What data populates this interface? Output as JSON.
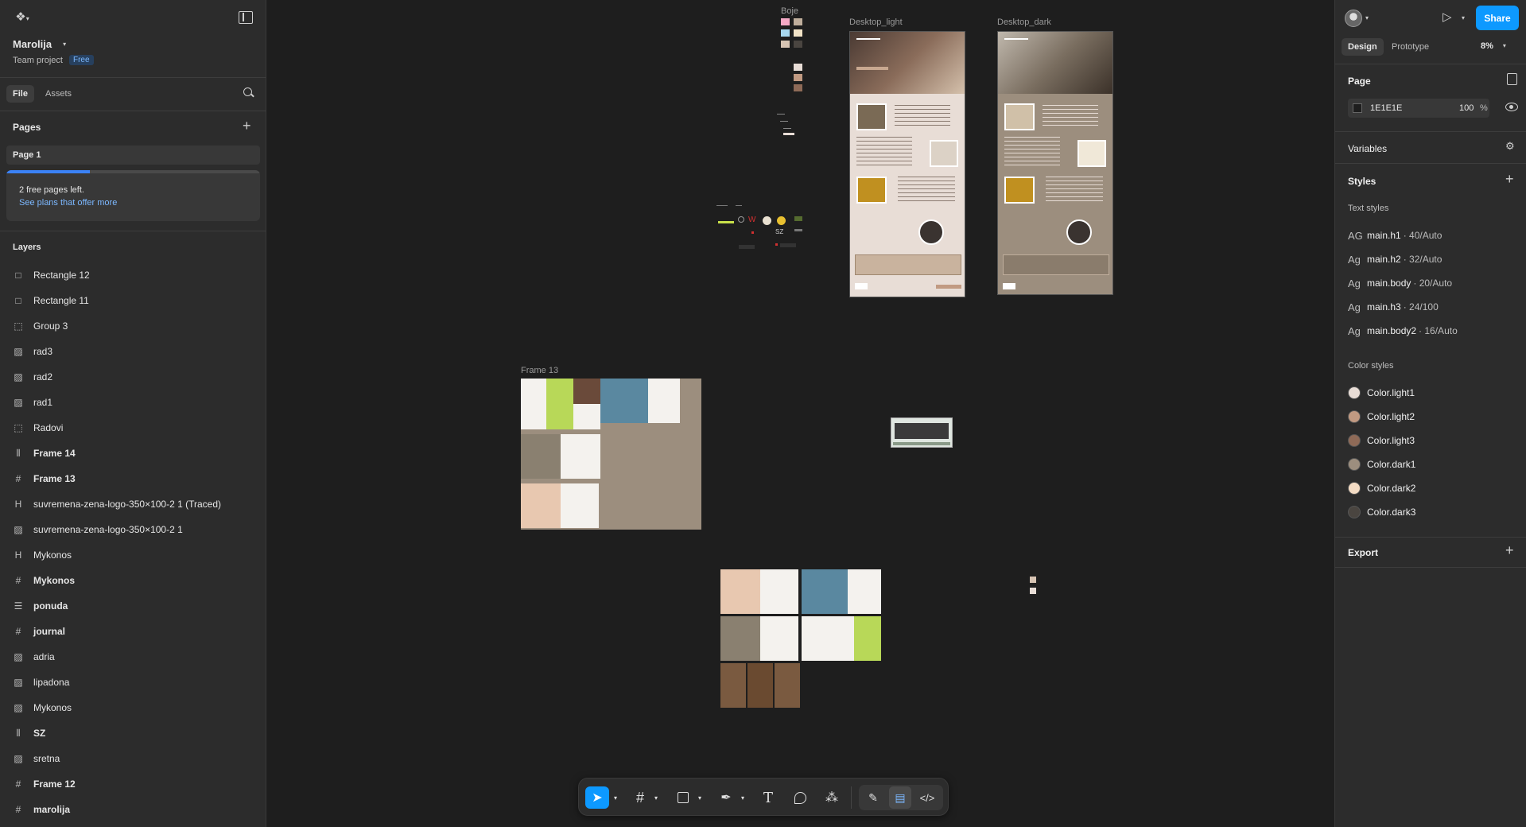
{
  "file": {
    "name": "Marolija",
    "team": "Team project",
    "plan": "Free"
  },
  "left_tabs": {
    "file": "File",
    "assets": "Assets"
  },
  "pages": {
    "title": "Pages",
    "items": [
      "Page 1"
    ],
    "notice": "2 free pages left.",
    "notice_link": "See plans that offer more"
  },
  "layers": {
    "title": "Layers",
    "items": [
      {
        "icon": "rectangle-icon",
        "glyph": "□",
        "label": "Rectangle 12"
      },
      {
        "icon": "rectangle-icon",
        "glyph": "□",
        "label": "Rectangle 11"
      },
      {
        "icon": "group-icon",
        "glyph": "⬚",
        "label": "Group 3"
      },
      {
        "icon": "image-icon",
        "glyph": "▨",
        "label": "rad3"
      },
      {
        "icon": "image-icon",
        "glyph": "▨",
        "label": "rad2"
      },
      {
        "icon": "image-icon",
        "glyph": "▨",
        "label": "rad1"
      },
      {
        "icon": "group-icon",
        "glyph": "⬚",
        "label": "Radovi"
      },
      {
        "icon": "autolayout-icon",
        "glyph": "⫴",
        "label": "Frame 14"
      },
      {
        "icon": "frame-icon",
        "glyph": "#",
        "label": "Frame 13"
      },
      {
        "icon": "component-icon",
        "glyph": "H",
        "label": "suvremena-zena-logo-350×100-2 1 (Traced)"
      },
      {
        "icon": "image-icon",
        "glyph": "▨",
        "label": "suvremena-zena-logo-350×100-2 1"
      },
      {
        "icon": "component-icon",
        "glyph": "H",
        "label": "Mykonos"
      },
      {
        "icon": "frame-icon",
        "glyph": "#",
        "label": "Mykonos"
      },
      {
        "icon": "autolayout-stack-icon",
        "glyph": "☰",
        "label": "ponuda"
      },
      {
        "icon": "frame-icon",
        "glyph": "#",
        "label": "journal"
      },
      {
        "icon": "image-icon",
        "glyph": "▨",
        "label": "adria"
      },
      {
        "icon": "image-icon",
        "glyph": "▨",
        "label": "lipadona"
      },
      {
        "icon": "image-icon",
        "glyph": "▨",
        "label": "Mykonos"
      },
      {
        "icon": "autolayout-icon",
        "glyph": "⫴",
        "label": "SZ"
      },
      {
        "icon": "image-icon",
        "glyph": "▨",
        "label": "sretna"
      },
      {
        "icon": "frame-icon",
        "glyph": "#",
        "label": "Frame 12"
      },
      {
        "icon": "frame-icon",
        "glyph": "#",
        "label": "marolija"
      }
    ]
  },
  "header": {
    "share": "Share",
    "tab_design": "Design",
    "tab_prototype": "Prototype",
    "zoom": "8%"
  },
  "page_panel": {
    "title": "Page",
    "bg_hex": "1E1E1E",
    "opacity": "100",
    "pct": "%",
    "bg_color": "#1e1e1e"
  },
  "variables": {
    "title": "Variables"
  },
  "styles": {
    "title": "Styles",
    "text_title": "Text styles",
    "text": [
      {
        "ag": "AG",
        "name": "main.h1",
        "meta": "· 40/Auto"
      },
      {
        "ag": "Ag",
        "name": "main.h2",
        "meta": "· 32/Auto"
      },
      {
        "ag": "Ag",
        "name": "main.body",
        "meta": "· 20/Auto"
      },
      {
        "ag": "Ag",
        "name": "main.h3",
        "meta": "· 24/100"
      },
      {
        "ag": "Ag",
        "name": "main.body2",
        "meta": "· 16/Auto"
      }
    ],
    "color_title": "Color styles",
    "colors": [
      {
        "name": "Color.light1",
        "hex": "#e8ddd6"
      },
      {
        "name": "Color.light2",
        "hex": "#c19a82"
      },
      {
        "name": "Color.light3",
        "hex": "#8e6a57"
      },
      {
        "name": "Color.dark1",
        "hex": "#9c8e7e"
      },
      {
        "name": "Color.dark2",
        "hex": "#f4dcc4"
      },
      {
        "name": "Color.dark3",
        "hex": "#4a4540"
      }
    ]
  },
  "export": {
    "title": "Export"
  },
  "canvas": {
    "label_boje": "Boje",
    "label_light": "Desktop_light",
    "label_dark": "Desktop_dark",
    "label_frame13": "Frame 13"
  },
  "help": "?"
}
